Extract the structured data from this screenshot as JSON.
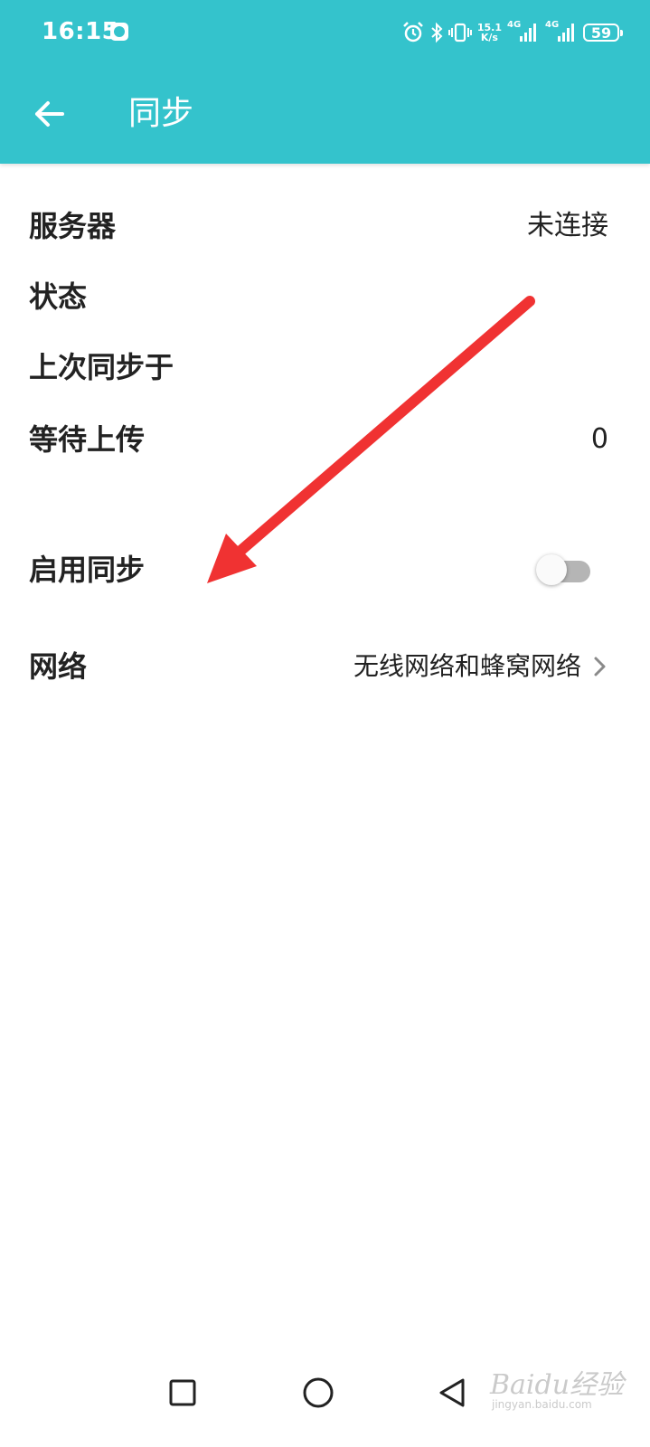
{
  "status_bar": {
    "time": "16:15",
    "net_speed_value": "15.1",
    "net_speed_unit": "K/s",
    "signal1_label": "4G",
    "signal2_label": "4G",
    "battery": "59",
    "icons": [
      "alarm-icon",
      "bluetooth-icon",
      "vibrate-icon",
      "signal-icon",
      "signal-icon"
    ]
  },
  "app_bar": {
    "title": "同步",
    "back_icon": "arrow-left-icon",
    "background_color": "#34c3cc"
  },
  "settings": {
    "server": {
      "label": "服务器",
      "value": "未连接"
    },
    "status": {
      "label": "状态"
    },
    "last_sync": {
      "label": "上次同步于"
    },
    "pending_upload": {
      "label": "等待上传",
      "value": "0"
    },
    "enable_sync": {
      "label": "启用同步",
      "enabled": false
    },
    "network": {
      "label": "网络",
      "value": "无线网络和蜂窝网络"
    }
  },
  "annotation": {
    "color": "#f03232"
  },
  "nav_bar": {
    "buttons": [
      "recents-square-icon",
      "home-circle-icon",
      "back-triangle-icon"
    ]
  },
  "watermark": {
    "brand": "Baidu经验",
    "site": "jingyan.baidu.com"
  }
}
